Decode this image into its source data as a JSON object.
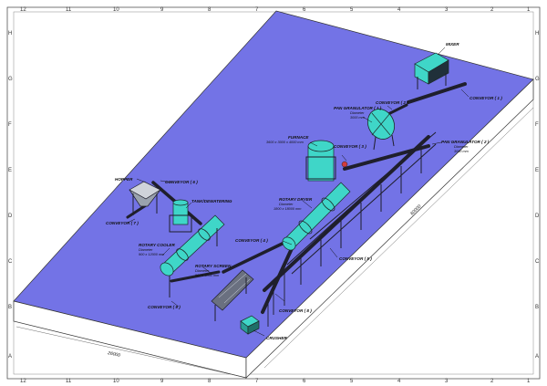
{
  "sheet": {
    "top_columns": [
      "12",
      "11",
      "10",
      "9",
      "8",
      "7",
      "6",
      "5",
      "4",
      "3",
      "2",
      "1"
    ],
    "bottom_columns": [
      "12",
      "11",
      "10",
      "9",
      "8",
      "7",
      "6",
      "5",
      "4",
      "3",
      "2",
      "1"
    ],
    "left_rows": [
      "H",
      "G",
      "F",
      "E",
      "D",
      "C",
      "B",
      "A"
    ],
    "right_rows": [
      "H",
      "G",
      "F",
      "E",
      "D",
      "C",
      "B",
      "A"
    ]
  },
  "dimensions": {
    "length": "60000",
    "width": "26000"
  },
  "equipment": {
    "mixer": "MIXER",
    "conveyor_1": "CONVEYOR ( 1 )",
    "conveyor_2": "CONVEYOR ( 2 )",
    "conveyor_3": "CONVEYOR ( 3 )",
    "conveyor_4": "CONVEYOR ( 4 )",
    "conveyor_5": "CONVEYOR ( 5 )",
    "conveyor_6": "CONVEYOR ( 6 )",
    "conveyor_7": "CONVEYOR ( 7 )",
    "conveyor_8": "CONVEYOR ( 8 )",
    "conveyor_9": "CONVEYOR ( 9 )",
    "pan_gran_1": {
      "title": "PAN GRANULATOR ( 1 )",
      "sub1": "Diameter",
      "sub2": "3000 mm"
    },
    "pan_gran_2": {
      "title": "PAN GRANULATOR ( 2 )",
      "sub1": "Diameter",
      "sub2": "3000 mm"
    },
    "furnace": {
      "title": "FURNACE",
      "sub1": "3600 x 3000 x 4000 mm"
    },
    "dryer": {
      "title": "ROTARY DRYER",
      "sub1": "Diameter",
      "sub2": "1800 x 18000 mm"
    },
    "hopper": "HOPPER",
    "tank": "TANK/DEWATERING",
    "cooler": {
      "title": "ROTARY COOLER",
      "sub1": "Diameter",
      "sub2": "900 x 12000 mm"
    },
    "screen": {
      "title": "ROTARY SCREEN",
      "sub1": "Diameter",
      "sub2": "900 x 6000 mm"
    },
    "crusher": "CRUSHER"
  },
  "colors": {
    "platform": "#7373e6",
    "platform_side": "#ffffff",
    "machine": "#3fd6c8",
    "steel": "#2a2a3a"
  }
}
